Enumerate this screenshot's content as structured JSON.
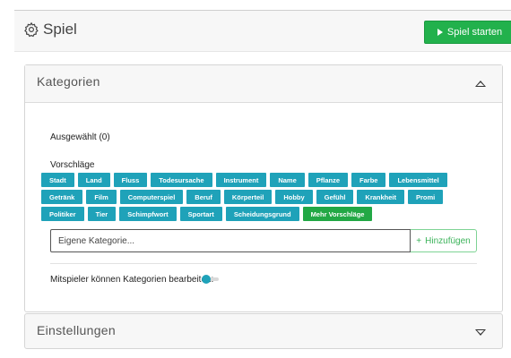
{
  "header": {
    "title": "Spiel",
    "start_label": "Spiel starten"
  },
  "categories_panel": {
    "title": "Kategorien",
    "selected_label": "Ausgewählt (0)",
    "suggestions_label": "Vorschläge",
    "chips": [
      "Stadt",
      "Land",
      "Fluss",
      "Todesursache",
      "Instrument",
      "Name",
      "Pflanze",
      "Farbe",
      "Lebensmittel",
      "Getränk",
      "Film",
      "Computerspiel",
      "Beruf",
      "Körperteil",
      "Hobby",
      "Gefühl",
      "Krankheit",
      "Promi",
      "Politiker",
      "Tier",
      "Schimpfwort",
      "Sportart",
      "Scheidungsgrund"
    ],
    "more_label": "Mehr Vorschläge",
    "input_placeholder": "Eigene Kategorie...",
    "add_label": "Hinzufügen",
    "toggle_label": "Mitspieler können Kategorien bearbeiten:",
    "toggle_on": false
  },
  "settings_panel": {
    "title": "Einstellungen"
  },
  "colors": {
    "accent_teal": "#1fa2b9",
    "accent_green": "#22b14c"
  }
}
